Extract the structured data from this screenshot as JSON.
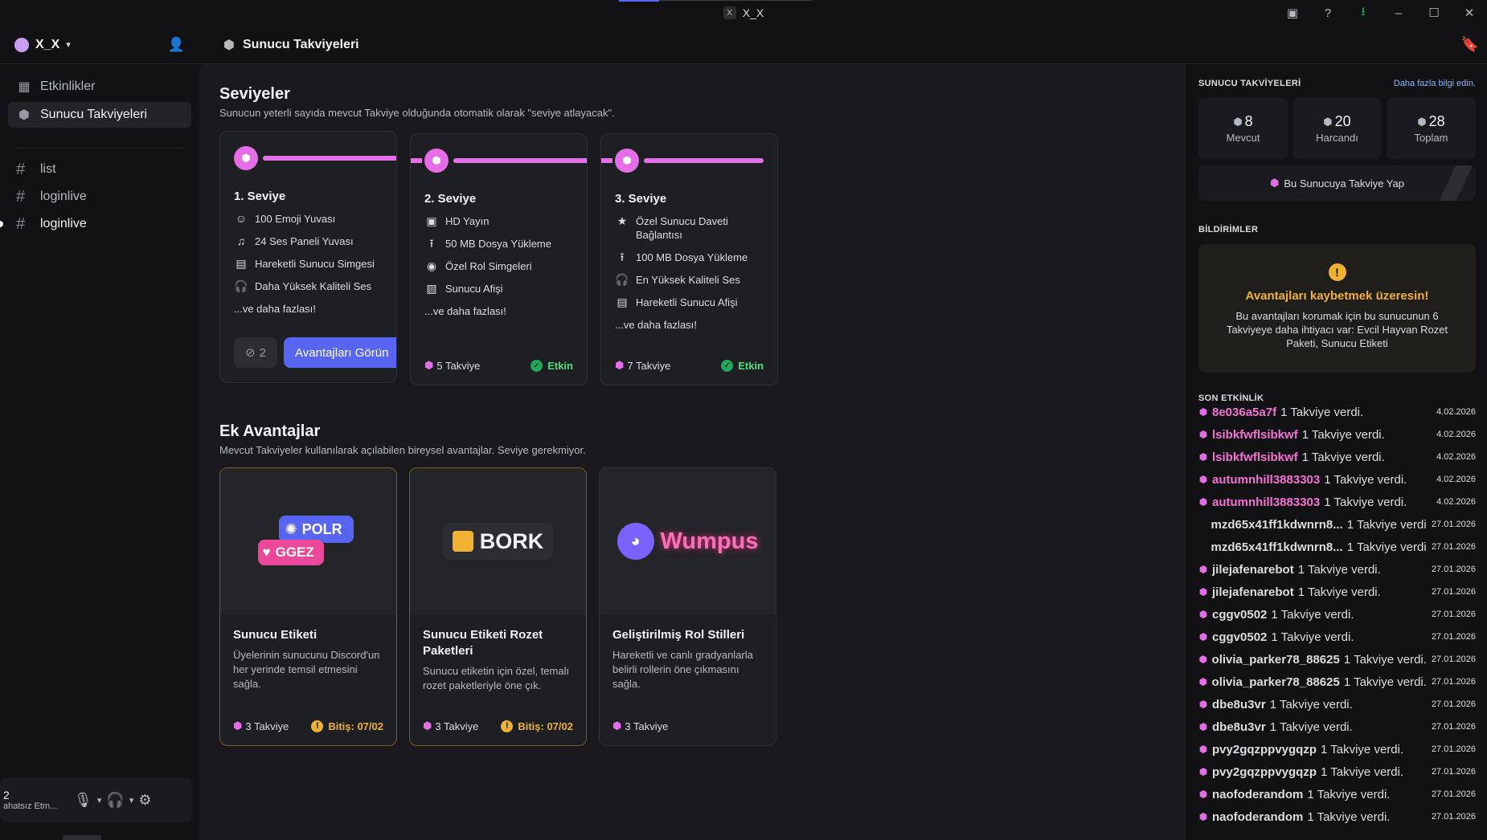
{
  "window": {
    "app_icon_text": "X",
    "title": "X_X"
  },
  "guild": {
    "name": "X_X"
  },
  "nav": [
    {
      "label": "Etkinlikler",
      "icon": "calendar-icon"
    },
    {
      "label": "Sunucu Takviyeleri",
      "icon": "boost-icon"
    }
  ],
  "channels": [
    "list",
    "loginlive",
    "loginlive"
  ],
  "user_panel": {
    "name": "2",
    "status": "ahatsız Etm..."
  },
  "topbar": {
    "title": "Sunucu Takviyeleri"
  },
  "levels_section": {
    "title": "Seviyeler",
    "subtitle": "Sunucun yeterli sayıda mevcut Takviye olduğunda otomatik olarak \"seviye atlayacak\"."
  },
  "levels": [
    {
      "name": "1. Seviye",
      "perks": [
        "100 Emoji Yuvası",
        "24 Ses Paneli Yuvası",
        "Hareketli Sunucu Simgesi",
        "Daha Yüksek Kaliteli Ses"
      ],
      "more": "...ve daha fazlası!",
      "count": "2",
      "button": "Avantajları Görün"
    },
    {
      "name": "2. Seviye",
      "perks": [
        "HD Yayın",
        "50 MB Dosya Yükleme",
        "Özel Rol Simgeleri",
        "Sunucu Afişi"
      ],
      "more": "...ve daha fazlası!",
      "boosts": "5 Takviye",
      "status": "Etkin"
    },
    {
      "name": "3. Seviye",
      "perks": [
        "Özel Sunucu Daveti Bağlantısı",
        "100 MB Dosya Yükleme",
        "En Yüksek Kaliteli Ses",
        "Hareketli Sunucu Afişi"
      ],
      "more": "...ve daha fazlası!",
      "boosts": "7 Takviye",
      "status": "Etkin"
    }
  ],
  "extras_section": {
    "title": "Ek Avantajlar",
    "subtitle": "Mevcut Takviyeler kullanılarak açılabilen bireysel avantajlar. Seviye gerekmiyor."
  },
  "extras": [
    {
      "title": "Sunucu Etiketi",
      "desc": "Üyelerinin sunucunu Discord'un her yerinde temsil etmesini sağla.",
      "boosts": "3 Takviye",
      "expire": "Bitiş: 07/02",
      "art": {
        "tag1": "POLR",
        "tag2": "GGEZ"
      }
    },
    {
      "title": "Sunucu Etiketi Rozet Paketleri",
      "desc": "Sunucu etiketin için özel, temalı rozet paketleriyle öne çık.",
      "boosts": "3 Takviye",
      "expire": "Bitiş: 07/02",
      "art": {
        "text": "BORK"
      }
    },
    {
      "title": "Geliştirilmiş Rol Stilleri",
      "desc": "Hareketli ve canlı gradyanlarla belirli rollerin öne çıkmasını sağla.",
      "boosts": "3 Takviye",
      "art": {
        "text": "Wumpus"
      }
    }
  ],
  "rail": {
    "heading": "SUNUCU TAKVİYELERİ",
    "link": "Daha fazla bilgi edin.",
    "stats": [
      {
        "value": "8",
        "label": "Mevcut"
      },
      {
        "value": "20",
        "label": "Harcandı"
      },
      {
        "value": "28",
        "label": "Toplam"
      }
    ],
    "boost_button": "Bu Sunucuya Takviye Yap",
    "notif_heading": "BİLDİRİMLER",
    "notif_title": "Avantajları kaybetmek üzeresin!",
    "notif_body": "Bu avantajları korumak için bu sunucunun 6 Takviyeye daha ihtiyacı var: Evcil Hayvan Rozet Paketi, Sunucu Etiketi",
    "activity_heading": "SON ETKİNLİK",
    "activity": [
      {
        "user": "8e036a5a7f",
        "msg": "1 Takviye verdi.",
        "date": "4.02.2026",
        "pink": true,
        "gem": true
      },
      {
        "user": "lsibkfwflsibkwf",
        "msg": "1 Takviye verdi.",
        "date": "4.02.2026",
        "pink": true,
        "gem": true
      },
      {
        "user": "lsibkfwflsibkwf",
        "msg": "1 Takviye verdi.",
        "date": "4.02.2026",
        "pink": true,
        "gem": true
      },
      {
        "user": "autumnhill3883303",
        "msg": "1 Takviye verdi.",
        "date": "4.02.2026",
        "pink": true,
        "gem": true
      },
      {
        "user": "autumnhill3883303",
        "msg": "1 Takviye verdi.",
        "date": "4.02.2026",
        "pink": true,
        "gem": true
      },
      {
        "user": "mzd65x41ff1kdwnrn8...",
        "msg": "1 Takviye verdi.",
        "date": "27.01.2026",
        "pink": false,
        "gem": false
      },
      {
        "user": "mzd65x41ff1kdwnrn8...",
        "msg": "1 Takviye verdi.",
        "date": "27.01.2026",
        "pink": false,
        "gem": false
      },
      {
        "user": "jilejafenarebot",
        "msg": "1 Takviye verdi.",
        "date": "27.01.2026",
        "pink": false,
        "gem": true
      },
      {
        "user": "jilejafenarebot",
        "msg": "1 Takviye verdi.",
        "date": "27.01.2026",
        "pink": false,
        "gem": true
      },
      {
        "user": "cggv0502",
        "msg": "1 Takviye verdi.",
        "date": "27.01.2026",
        "pink": false,
        "gem": true
      },
      {
        "user": "cggv0502",
        "msg": "1 Takviye verdi.",
        "date": "27.01.2026",
        "pink": false,
        "gem": true
      },
      {
        "user": "olivia_parker78_88625",
        "msg": "1 Takviye verdi.",
        "date": "27.01.2026",
        "pink": false,
        "gem": true
      },
      {
        "user": "olivia_parker78_88625",
        "msg": "1 Takviye verdi.",
        "date": "27.01.2026",
        "pink": false,
        "gem": true
      },
      {
        "user": "dbe8u3vr",
        "msg": "1 Takviye verdi.",
        "date": "27.01.2026",
        "pink": false,
        "gem": true
      },
      {
        "user": "dbe8u3vr",
        "msg": "1 Takviye verdi.",
        "date": "27.01.2026",
        "pink": false,
        "gem": true
      },
      {
        "user": "pvy2gqzppvygqzp",
        "msg": "1 Takviye verdi.",
        "date": "27.01.2026",
        "pink": false,
        "gem": true
      },
      {
        "user": "pvy2gqzppvygqzp",
        "msg": "1 Takviye verdi.",
        "date": "27.01.2026",
        "pink": false,
        "gem": true
      },
      {
        "user": "naofoderandom",
        "msg": "1 Takviye verdi.",
        "date": "27.01.2026",
        "pink": false,
        "gem": true
      },
      {
        "user": "naofoderandom",
        "msg": "1 Takviye verdi.",
        "date": "27.01.2026",
        "pink": false,
        "gem": true
      }
    ]
  },
  "colors": {
    "accent": "#5865f2",
    "boost_pink": "#e56de8",
    "success": "#23a55a",
    "warning": "#f0b232"
  }
}
